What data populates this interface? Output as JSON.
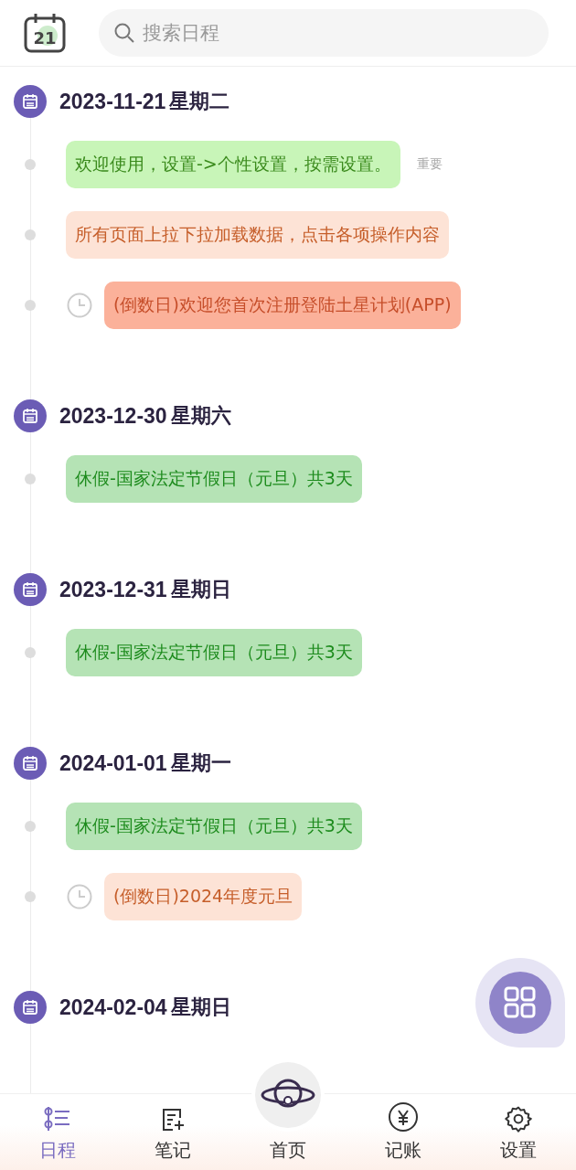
{
  "header": {
    "app_icon_text": "21",
    "search": {
      "placeholder": "搜索日程"
    }
  },
  "days": [
    {
      "date": "2023-11-21",
      "weekday": "星期二",
      "events": [
        {
          "text": "欢迎使用，设置->个性设置，按需设置。",
          "kind": "plain",
          "color": "#c8f5b8",
          "tag": "重要"
        },
        {
          "text": "所有页面上拉下拉加载数据，点击各项操作内容",
          "kind": "plain",
          "color": "#fde3d6"
        },
        {
          "text": "(倒数日)欢迎您首次注册登陆土星计划(APP)",
          "kind": "countdown",
          "color": "#fbb19a"
        }
      ]
    },
    {
      "date": "2023-12-30",
      "weekday": "星期六",
      "events": [
        {
          "text": "休假-国家法定节假日（元旦）共3天",
          "kind": "plain",
          "color": "#b5e3b5"
        }
      ]
    },
    {
      "date": "2023-12-31",
      "weekday": "星期日",
      "events": [
        {
          "text": "休假-国家法定节假日（元旦）共3天",
          "kind": "plain",
          "color": "#b5e3b5"
        }
      ]
    },
    {
      "date": "2024-01-01",
      "weekday": "星期一",
      "events": [
        {
          "text": "休假-国家法定节假日（元旦）共3天",
          "kind": "plain",
          "color": "#b5e3b5"
        },
        {
          "text": "(倒数日)2024年度元旦",
          "kind": "countdown",
          "color": "#fde3d6"
        }
      ]
    },
    {
      "date": "2024-02-04",
      "weekday": "星期日"
    }
  ],
  "nav": [
    {
      "label": "日程",
      "selected": true
    },
    {
      "label": "笔记",
      "selected": false
    },
    {
      "label": "首页",
      "selected": false
    },
    {
      "label": "记账",
      "selected": false
    },
    {
      "label": "设置",
      "selected": false
    }
  ]
}
